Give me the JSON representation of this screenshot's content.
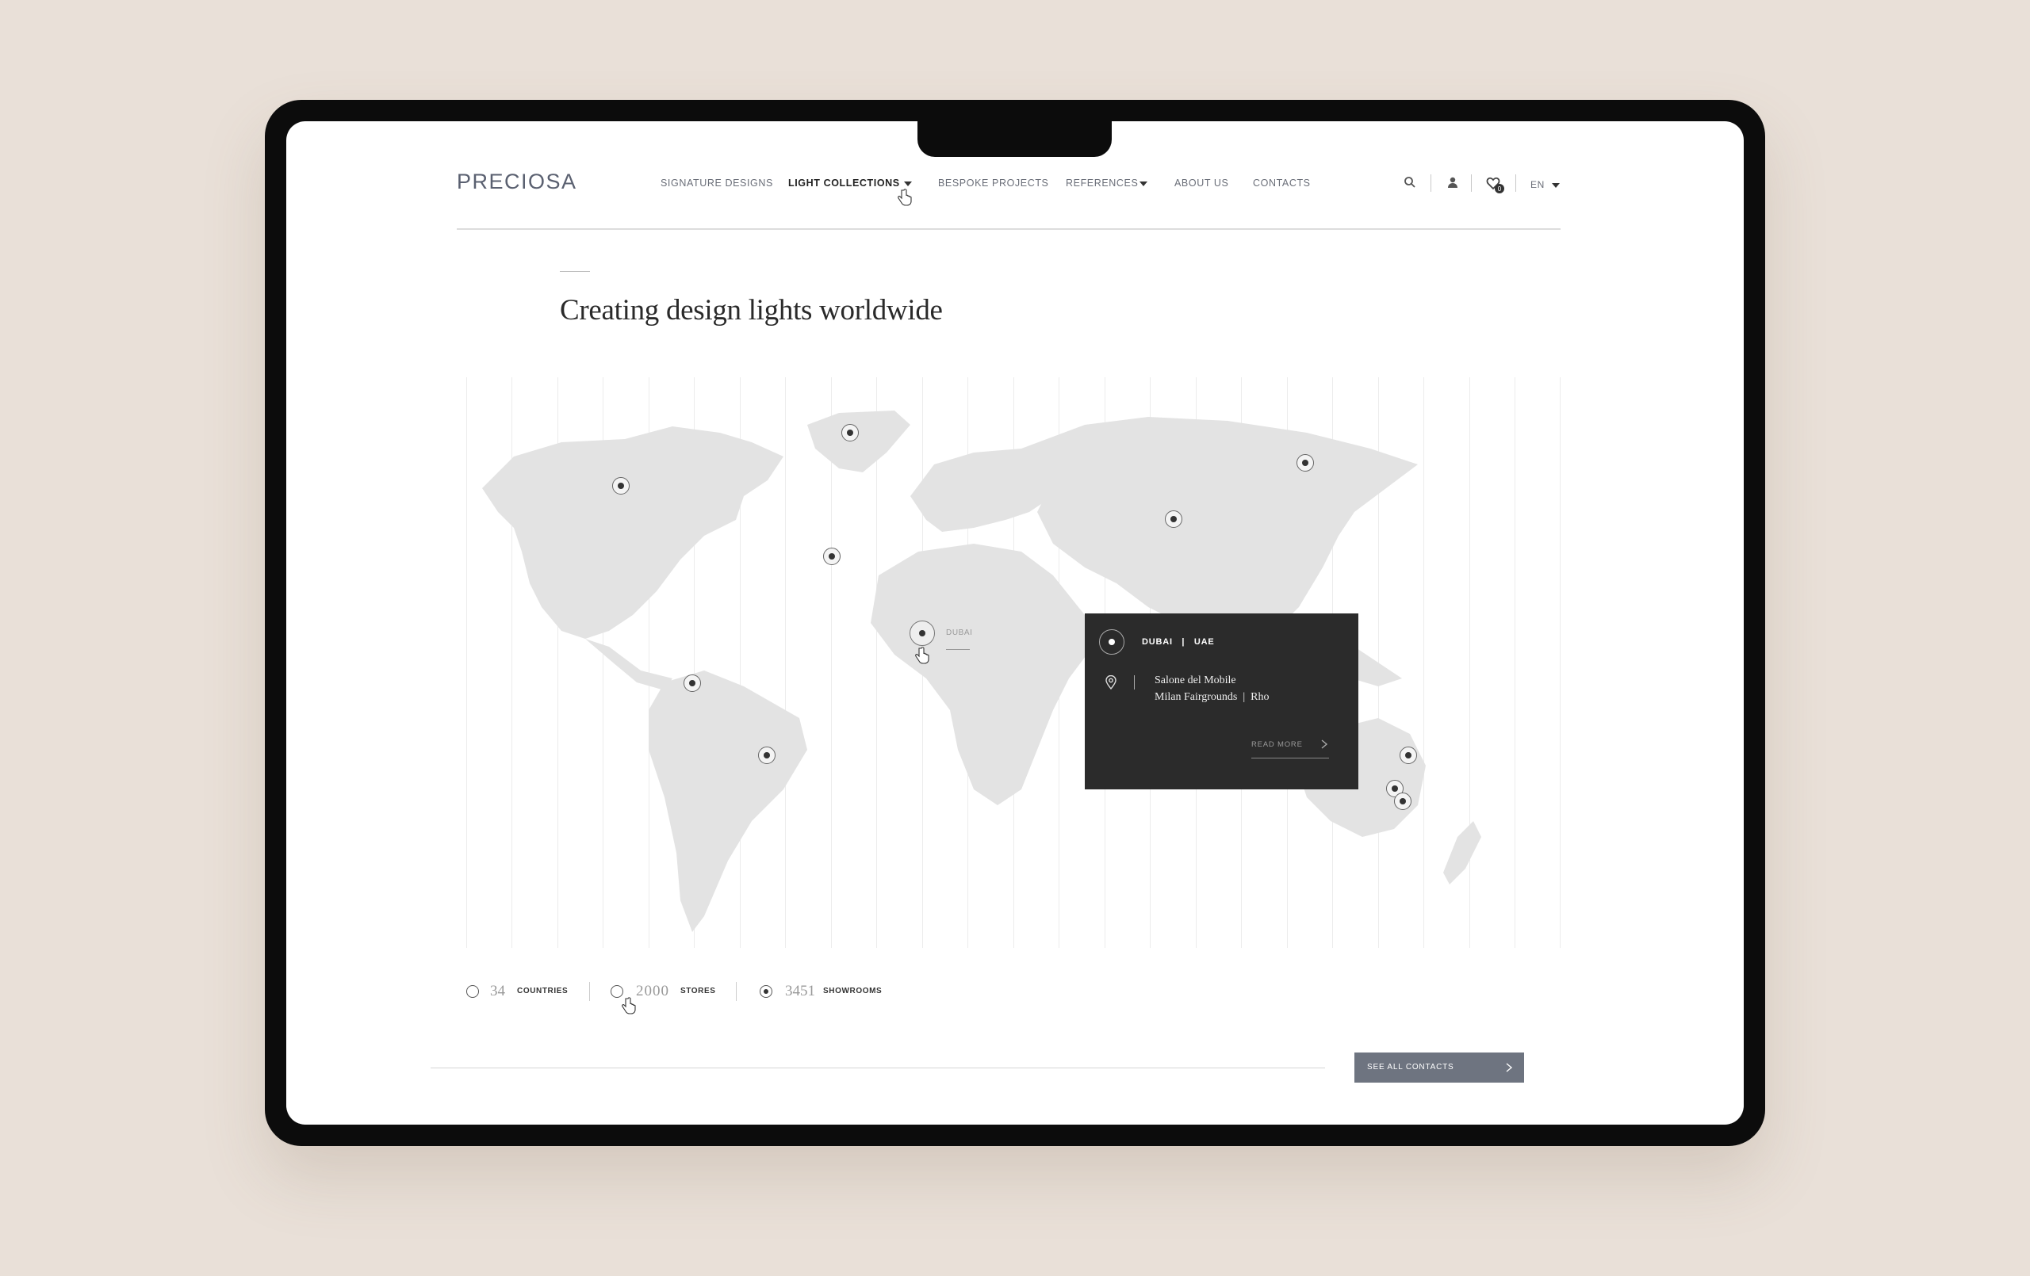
{
  "brand": {
    "logo": "PRECIOSA"
  },
  "nav": {
    "items": [
      {
        "label": "SIGNATURE DESIGNS",
        "dropdown": false
      },
      {
        "label": "LIGHT COLLECTIONS",
        "dropdown": true,
        "active": true
      },
      {
        "label": "BESPOKE PROJECTS",
        "dropdown": false
      },
      {
        "label": "REFERENCES",
        "dropdown": true
      },
      {
        "label": "ABOUT US",
        "dropdown": false
      },
      {
        "label": "CONTACTS",
        "dropdown": false
      }
    ],
    "utilities": {
      "icons": [
        "search-icon",
        "user-icon",
        "wishlist-icon"
      ],
      "wishlist_count": "0",
      "language": "EN"
    }
  },
  "page": {
    "title": "Creating design lights worldwide"
  },
  "map": {
    "hover_label": "DUBAI",
    "popup": {
      "city": "DUBAI   |   UAE",
      "venue": "Salone del Mobile",
      "address": "Milan Fairgrounds  |  Rho",
      "read_more": "READ MORE"
    }
  },
  "stats": [
    {
      "number": "34",
      "label": "COUNTRIES",
      "selected": false
    },
    {
      "number": "2000",
      "label": "STORES",
      "selected": false
    },
    {
      "number": "3451",
      "label": "SHOWROOMS",
      "selected": true
    }
  ],
  "footer": {
    "button_label": "SEE ALL CONTACTS"
  },
  "colors": {
    "background": "#e9e0d8",
    "map_land": "#e3e3e3",
    "popup_bg": "#2b2b2b",
    "button_bg": "#6e7480"
  }
}
